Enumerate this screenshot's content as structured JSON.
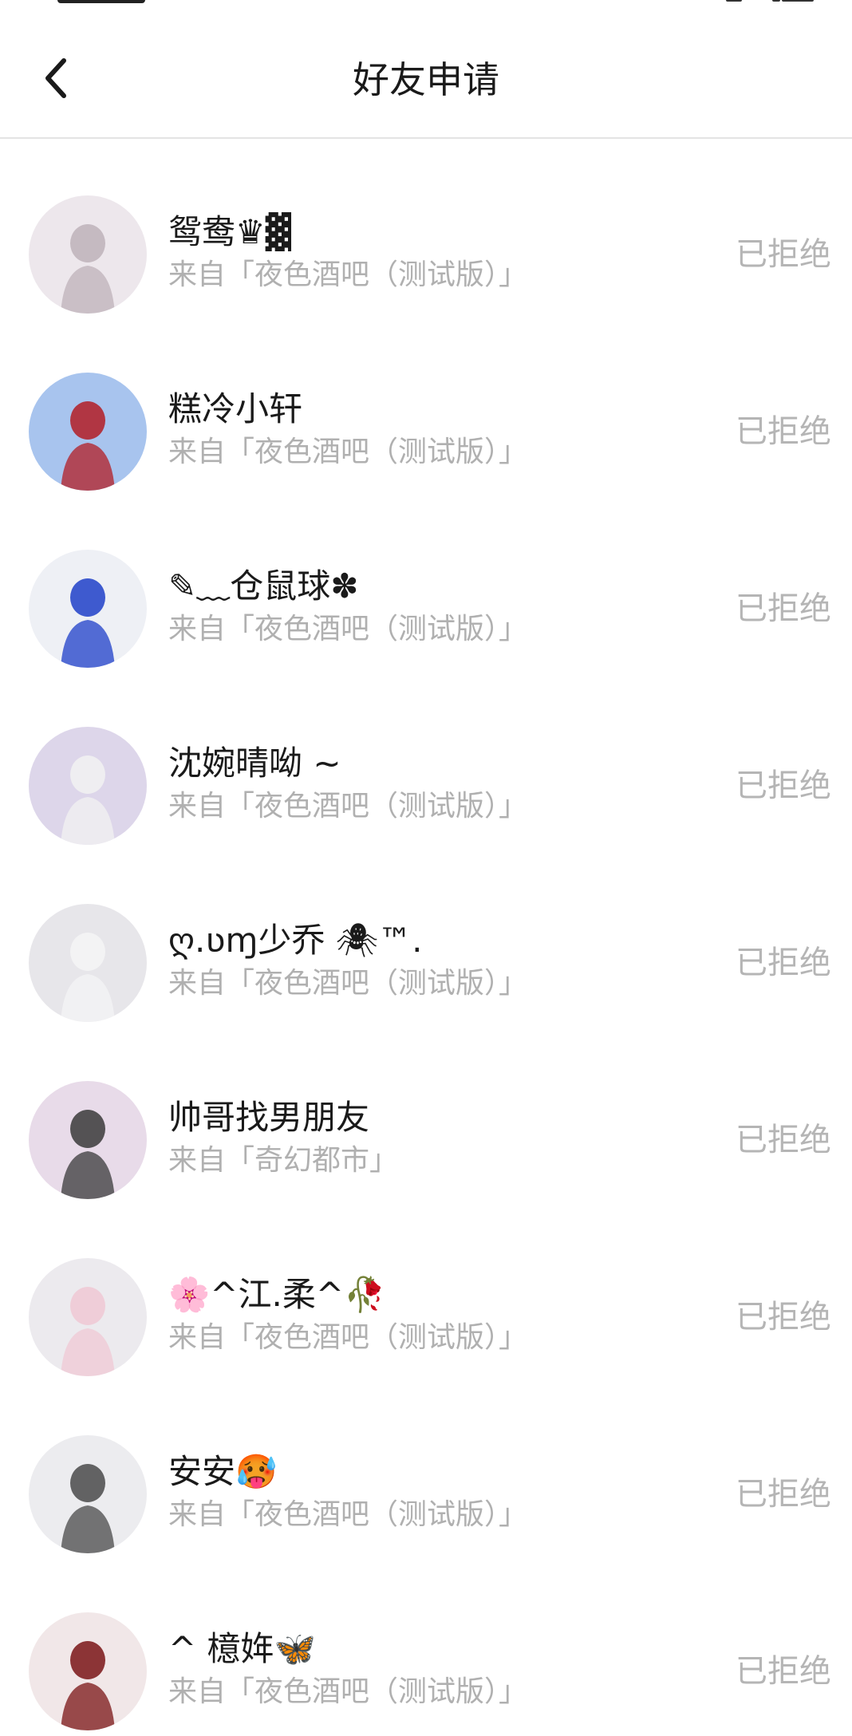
{
  "header": {
    "title": "好友申请",
    "back_icon": "chevron-left-icon"
  },
  "requests": [
    {
      "name": "鸳鸯♛▓",
      "source": "来自「夜色酒吧（测试版）」",
      "status": "已拒绝",
      "avatar_bg": "#ede7ec",
      "avatar_fg": "#bdb2ba"
    },
    {
      "name": "糕冷小轩",
      "source": "来自「夜色酒吧（测试版）」",
      "status": "已拒绝",
      "avatar_bg": "#a8c4ee",
      "avatar_fg": "#b31d24"
    },
    {
      "name": "✎﹏仓鼠球✽",
      "source": "来自「夜色酒吧（测试版）」",
      "status": "已拒绝",
      "avatar_bg": "#eef0f5",
      "avatar_fg": "#1e3fc8"
    },
    {
      "name": "沈婉晴呦 ~",
      "source": "来自「夜色酒吧（测试版）」",
      "status": "已拒绝",
      "avatar_bg": "#ddd6ea",
      "avatar_fg": "#f2f2f2"
    },
    {
      "name": "ღ.ʋɱ少乔 🕷™.",
      "source": "来自「夜色酒吧（测试版）」",
      "status": "已拒绝",
      "avatar_bg": "#e7e6ea",
      "avatar_fg": "#f4f4f6"
    },
    {
      "name": "帅哥找男朋友",
      "source": "来自「奇幻都市」",
      "status": "已拒绝",
      "avatar_bg": "#e8dbe9",
      "avatar_fg": "#3a3a3a"
    },
    {
      "name": "🌸^江.柔^🥀",
      "source": "来自「夜色酒吧（测试版）」",
      "status": "已拒绝",
      "avatar_bg": "#eceaee",
      "avatar_fg": "#f0c8d4"
    },
    {
      "name": "安安🥵",
      "source": "来自「夜色酒吧（测试版）」",
      "status": "已拒绝",
      "avatar_bg": "#ececef",
      "avatar_fg": "#4a4a4a"
    },
    {
      "name": "^ 檍姩🦋",
      "source": "来自「夜色酒吧（测试版）」",
      "status": "已拒绝",
      "avatar_bg": "#f1e7e8",
      "avatar_fg": "#7a1416"
    }
  ]
}
